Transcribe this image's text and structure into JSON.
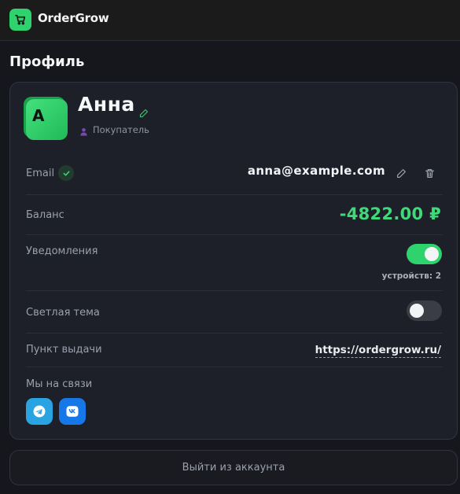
{
  "app": {
    "name": "OrderGrow",
    "logo_icon": "shopping-cart-icon",
    "accent_color": "#2fd36d"
  },
  "page": {
    "title": "Профиль"
  },
  "profile": {
    "avatar_letter": "A",
    "name": "Анна",
    "role": "Покупатель",
    "role_icon": "user-icon"
  },
  "rows": {
    "email": {
      "label": "Email",
      "value": "anna@example.com",
      "verified": true
    },
    "balance": {
      "label": "Баланс",
      "value": "-4822.00 ₽",
      "color": "#3fd97a"
    },
    "notifications": {
      "label": "Уведомления",
      "enabled": true,
      "devices_text": "устройств: 2"
    },
    "light_theme": {
      "label": "Светлая тема",
      "enabled": false
    },
    "pickup": {
      "label": "Пункт выдачи",
      "link": "https://ordergrow.ru/"
    },
    "contacts": {
      "label": "Мы на связи",
      "links": [
        "telegram-icon",
        "vk-icon"
      ]
    }
  },
  "logout_label": "Выйти из аккаунта"
}
